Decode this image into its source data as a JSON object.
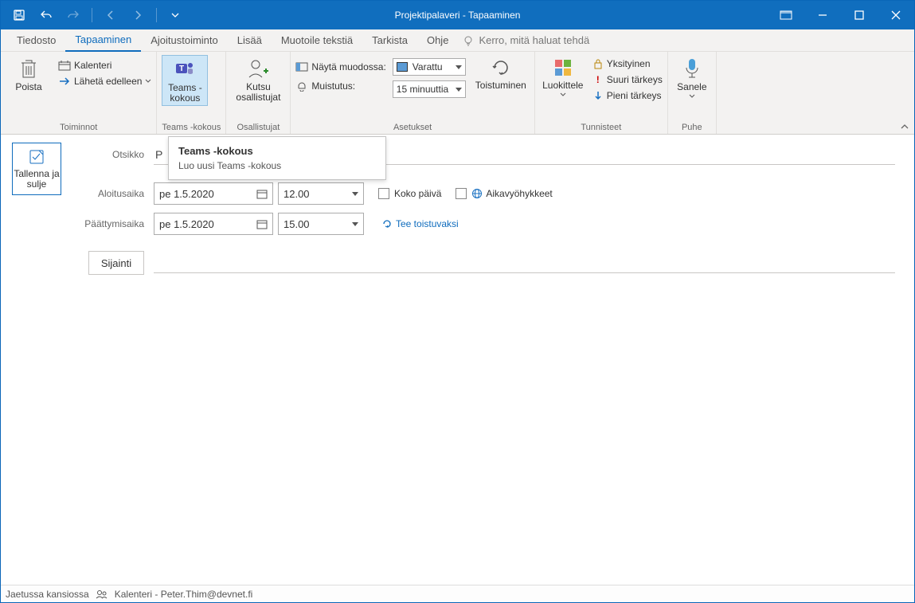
{
  "window": {
    "title": "Projektipalaveri  -  Tapaaminen"
  },
  "menu": {
    "tabs": [
      "Tiedosto",
      "Tapaaminen",
      "Ajoitustoiminto",
      "Lisää",
      "Muotoile tekstiä",
      "Tarkista",
      "Ohje"
    ],
    "active": 1,
    "tellme": "Kerro, mitä haluat tehdä"
  },
  "ribbon": {
    "toiminnot": {
      "label": "Toiminnot",
      "delete": "Poista",
      "calendar": "Kalenteri",
      "forward": "Lähetä edelleen"
    },
    "teams": {
      "label": "Teams -kokous",
      "btn": "Teams -\nkokous"
    },
    "osallistujat": {
      "label": "Osallistujat",
      "invite": "Kutsu osallistujat"
    },
    "asetukset": {
      "label": "Asetukset",
      "showas": "Näytä muodossa:",
      "showas_val": "Varattu",
      "reminder": "Muistutus:",
      "reminder_val": "15 minuuttia",
      "recur": "Toistuminen"
    },
    "tunnisteet": {
      "label": "Tunnisteet",
      "categorize": "Luokittele",
      "private": "Yksityinen",
      "high": "Suuri tärkeys",
      "low": "Pieni tärkeys"
    },
    "puhe": {
      "label": "Puhe",
      "dictate": "Sanele"
    }
  },
  "tooltip": {
    "title": "Teams -kokous",
    "body": "Luo uusi Teams -kokous"
  },
  "form": {
    "save_close": "Tallenna ja sulje",
    "title_label": "Otsikko",
    "title_value": "P",
    "start_label": "Aloitusaika",
    "start_date": "pe 1.5.2020",
    "start_time": "12.00",
    "allday": "Koko päivä",
    "tz": "Aikavyöhykkeet",
    "end_label": "Päättymisaika",
    "end_date": "pe 1.5.2020",
    "end_time": "15.00",
    "recurrence": "Tee toistuvaksi",
    "location_btn": "Sijainti"
  },
  "status": {
    "folder": "Jaetussa kansiossa",
    "cal": "Kalenteri - Peter.Thim@devnet.fi"
  }
}
